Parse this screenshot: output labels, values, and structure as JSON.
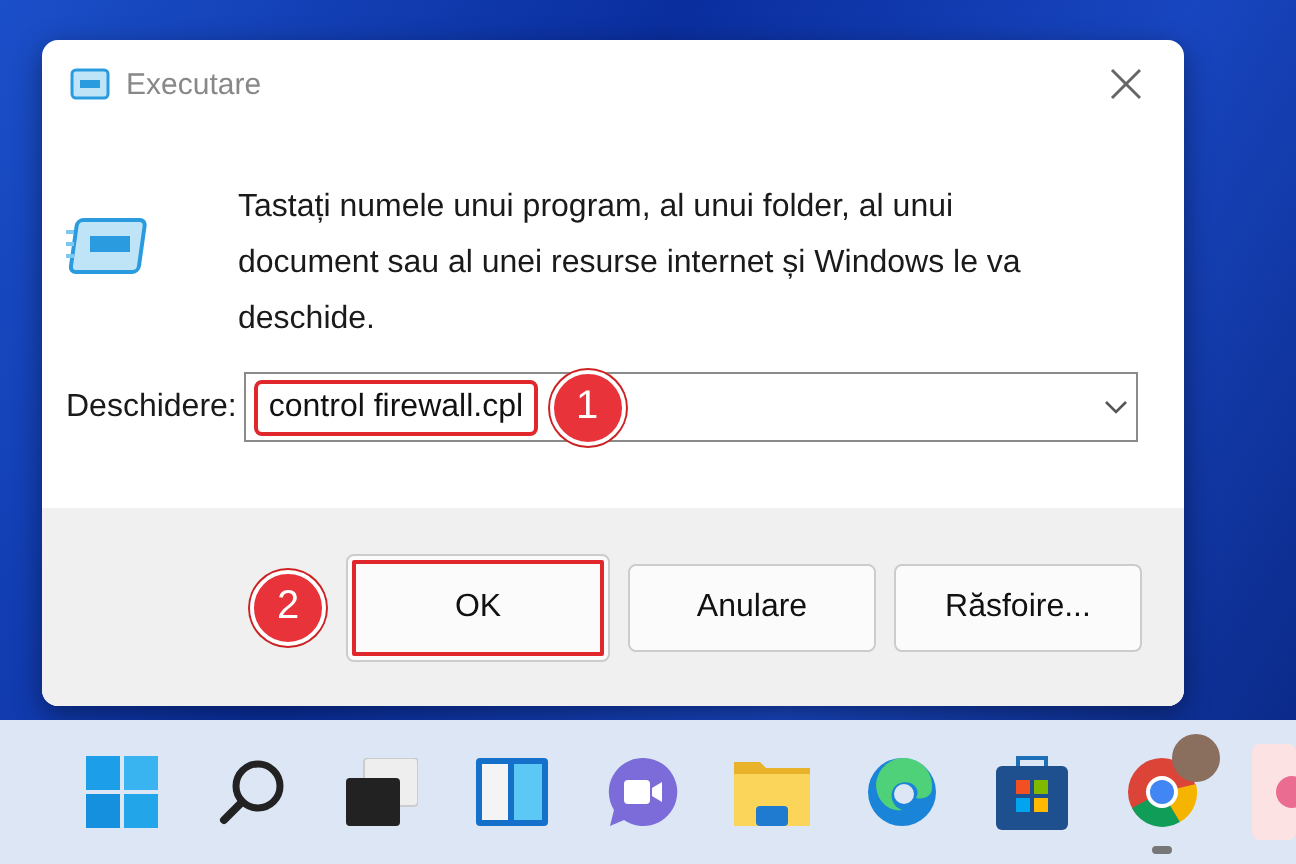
{
  "window": {
    "title": "Executare"
  },
  "message": "Tastați numele unui program, al unui folder, al unui document sau al unei resurse internet și Windows le va deschide.",
  "open_field": {
    "label": "Deschidere:",
    "value": "control firewall.cpl",
    "highlighted": true,
    "badge": "1"
  },
  "buttons": [
    {
      "label": "OK",
      "highlighted": true,
      "badge": "2"
    },
    {
      "label": "Anulare",
      "highlighted": false
    },
    {
      "label": "Răsfoire...",
      "highlighted": false
    }
  ],
  "taskbar": [
    {
      "kind": "start",
      "running": false
    },
    {
      "kind": "search",
      "running": false
    },
    {
      "kind": "taskview",
      "running": false
    },
    {
      "kind": "widgets",
      "running": false
    },
    {
      "kind": "chat",
      "running": false
    },
    {
      "kind": "explorer",
      "running": false
    },
    {
      "kind": "edge",
      "running": false
    },
    {
      "kind": "store",
      "running": false
    },
    {
      "kind": "chrome",
      "running": true
    },
    {
      "kind": "partial",
      "running": false
    }
  ]
}
